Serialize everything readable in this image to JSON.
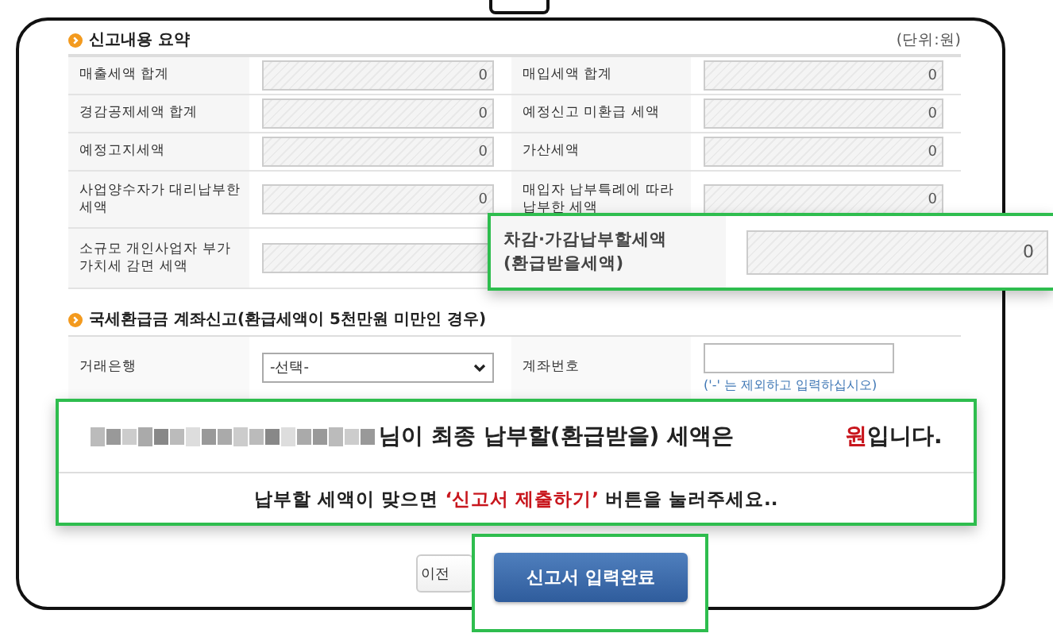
{
  "summary": {
    "title": "신고내용 요약",
    "unit": "(단위:원)",
    "rows": [
      [
        {
          "label": "매출세액 합계",
          "value": "0"
        },
        {
          "label": "매입세액 합계",
          "value": "0"
        }
      ],
      [
        {
          "label": "경감공제세액 합계",
          "value": "0"
        },
        {
          "label": "예정신고 미환급 세액",
          "value": "0"
        }
      ],
      [
        {
          "label": "예정고지세액",
          "value": "0"
        },
        {
          "label": "가산세액",
          "value": "0"
        }
      ],
      [
        {
          "label": "사업양수자가 대리납부한 세액",
          "value": "0"
        },
        {
          "label": "매입자 납부특례에 따라 납부한 세액",
          "value": "0"
        }
      ],
      [
        {
          "label": "소규모 개인사업자 부가가치세 감면 세액"
        }
      ]
    ]
  },
  "refund_account": {
    "title": "국세환급금 계좌신고(환급세액이 5천만원 미만인 경우)",
    "bank_label": "거래은행",
    "bank_select": "-선택-",
    "account_label": "계좌번호",
    "account_hint": "('-' 는 제외하고 입력하십시오)"
  },
  "final_tax_callout": {
    "label": "차감·가감납부할세액 (환급받을세액)",
    "value": "0"
  },
  "message_callout": {
    "line1": "님이 최종 납부할(환급받을) 세액은",
    "unit": "원",
    "suffix": "입니다.",
    "line2_before": "납부할 세액이 맞으면 ",
    "line2_highlight": "‘신고서 제출하기’",
    "line2_after": " 버튼을 눌러주세요.."
  },
  "buttons": {
    "prev": "이전",
    "submit": "신고서 입력완료"
  }
}
